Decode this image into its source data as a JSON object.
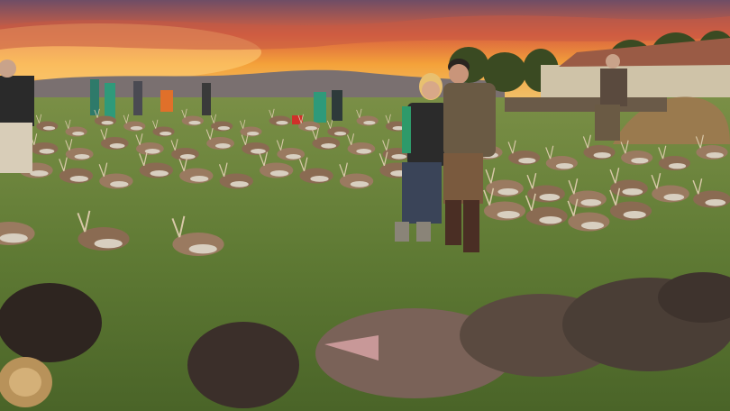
{
  "photo": {
    "colors": {
      "sky_top": "#7a5a6e",
      "sky_glow": "#f4a23a",
      "sky_red": "#e0623a",
      "hills": "#6e6a6a",
      "grass": "#5f7a34",
      "grass_dark": "#3e5524",
      "deer": "#8a6b52",
      "boar": "#3b2f2a",
      "building": "#cfc3a8",
      "roof": "#9a5b45",
      "trees": "#3a4a22"
    }
  }
}
